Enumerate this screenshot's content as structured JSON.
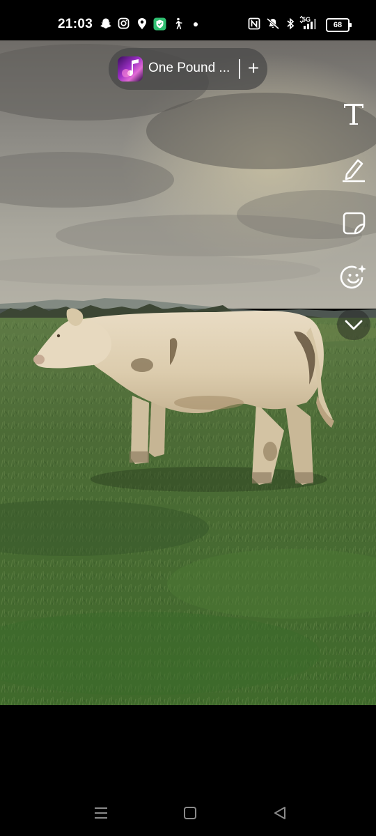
{
  "status_bar": {
    "time": "21:03",
    "left_icons": [
      "snapchat-icon",
      "instagram-icon",
      "location-icon",
      "vpn-shield-icon",
      "walking-icon",
      "dot-icon"
    ],
    "right_icons": [
      "nfc-icon",
      "mute-icon",
      "bluetooth-icon",
      "signal-5g-icon"
    ],
    "network": "5G",
    "battery": "68"
  },
  "music_sticker": {
    "title": "One Pound ...",
    "add_label": "+"
  },
  "toolbar": {
    "tools": [
      "text-tool-icon",
      "pen-tool-icon",
      "sticker-tool-icon",
      "lens-tool-icon",
      "chevron-down-icon"
    ]
  },
  "photo": {
    "subject": "cow-in-field"
  },
  "nav_bar": {
    "buttons": [
      "recents-icon",
      "home-icon",
      "back-icon"
    ]
  },
  "colors": {
    "background": "#000000",
    "pill": "#464646",
    "accent_art": "#9b2fc4"
  }
}
